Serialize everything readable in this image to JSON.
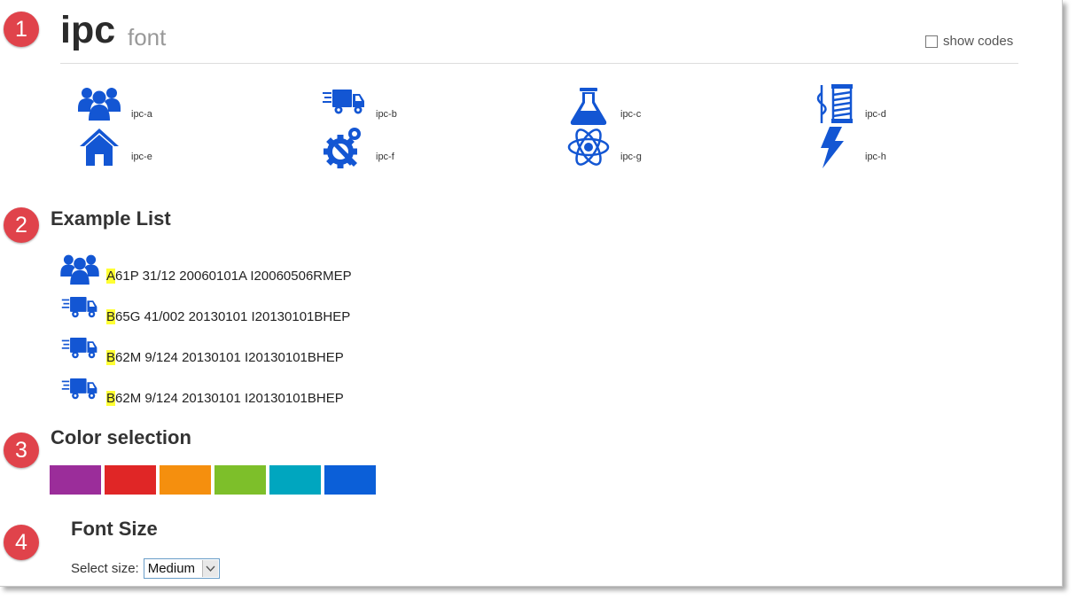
{
  "header": {
    "title": "ipc",
    "subtitle": "font",
    "show_codes_label": "show codes"
  },
  "markers": [
    "1",
    "2",
    "3",
    "4"
  ],
  "icons": [
    {
      "name": "users-icon",
      "label": "ipc-a"
    },
    {
      "name": "truck-icon",
      "label": "ipc-b"
    },
    {
      "name": "flask-icon",
      "label": "ipc-c"
    },
    {
      "name": "thread-needle-icon",
      "label": "ipc-d"
    },
    {
      "name": "house-icon",
      "label": "ipc-e"
    },
    {
      "name": "gear-wrench-icon",
      "label": "ipc-f"
    },
    {
      "name": "atom-icon",
      "label": "ipc-g"
    },
    {
      "name": "lightning-icon",
      "label": "ipc-h"
    }
  ],
  "example_list": {
    "heading": "Example List",
    "items": [
      {
        "icon": "users-icon",
        "first": "A",
        "rest": "61P 31/12 20060101A I20060506RMEP"
      },
      {
        "icon": "truck-icon",
        "first": "B",
        "rest": "65G 41/002 20130101 I20130101BHEP"
      },
      {
        "icon": "truck-icon",
        "first": "B",
        "rest": "62M 9/124 20130101 I20130101BHEP"
      },
      {
        "icon": "truck-icon",
        "first": "B",
        "rest": "62M 9/124 20130101 I20130101BHEP"
      }
    ]
  },
  "color_selection": {
    "heading": "Color selection",
    "colors": [
      "#9b2d9a",
      "#e02626",
      "#f58f0e",
      "#7dbf2a",
      "#00a6bf",
      "#0b5fd8"
    ]
  },
  "font_size": {
    "heading": "Font Size",
    "select_label": "Select size:",
    "selected": "Medium"
  },
  "icon_color": "#1356d3"
}
